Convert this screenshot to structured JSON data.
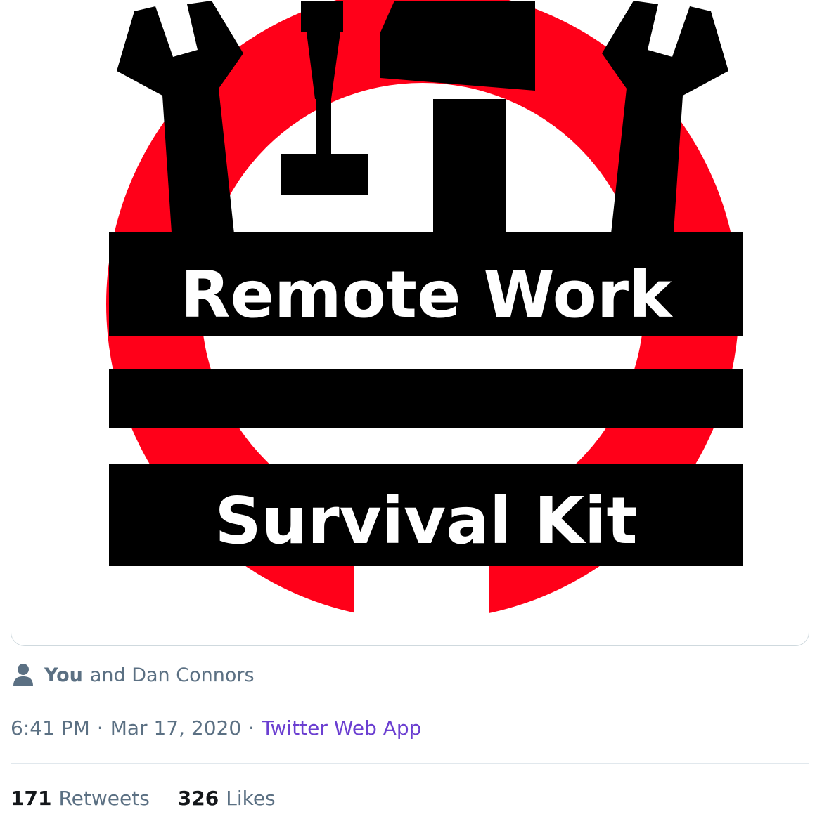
{
  "tweet": {
    "image": {
      "title_line1": "Remote Work",
      "title_line2": "Survival Kit",
      "colors": {
        "ring": "#ff0019",
        "tools": "#000000",
        "text": "#ffffff"
      }
    },
    "tagged": {
      "you_label": "You",
      "rest_label": "and Dan Connors",
      "icon": "person-icon"
    },
    "meta": {
      "time": "6:41 PM",
      "separator": "·",
      "date": "Mar 17, 2020",
      "source": "Twitter Web App"
    },
    "stats": {
      "retweets_count": "171",
      "retweets_label": "Retweets",
      "likes_count": "326",
      "likes_label": "Likes"
    }
  },
  "colors": {
    "secondary_text": "#5b7083",
    "source_link": "#6b3fd1",
    "count_text": "#14171a",
    "divider": "#e1e8ed"
  }
}
